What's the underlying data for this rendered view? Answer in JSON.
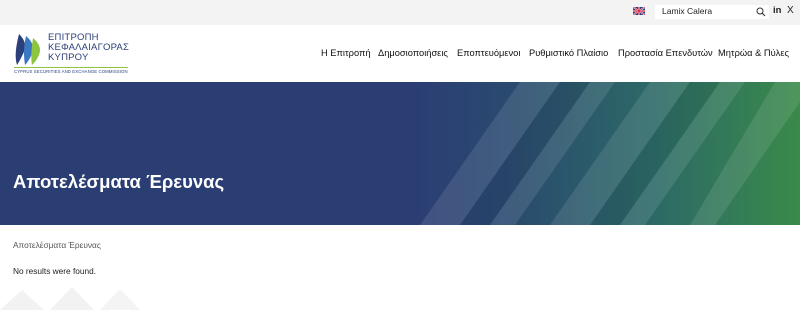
{
  "topbar": {
    "language_flag": "uk-flag-icon",
    "search_value": "Lamix Calera",
    "social": {
      "linkedin_label": "in",
      "x_label": "X"
    }
  },
  "logo": {
    "line1": "ΕΠΙΤΡΟΠΗ",
    "line2": "ΚΕΦΑΛΑΙΑΓΟΡΑΣ",
    "line3": "ΚΥΠΡΟΥ",
    "english": "CYPRUS SECURITIES AND EXCHANGE COMMISSION"
  },
  "nav": {
    "items": [
      "Η Επιτροπή",
      "Δημοσιοποιήσεις",
      "Εποπτευόμενοι",
      "Ρυθμιστικό Πλαίσιο",
      "Προστασία Επενδυτών",
      "Μητρώα & Πύλες"
    ]
  },
  "hero": {
    "title": "Αποτελέσματα Έρευνας"
  },
  "content": {
    "breadcrumb": "Αποτελέσματα Έρευνας",
    "message": "No results were found."
  },
  "colors": {
    "brand_blue": "#2b3e74",
    "brand_green": "#3a8a4a",
    "logo_blue": "#2b3f7a",
    "logo_green": "#8cc63f"
  }
}
